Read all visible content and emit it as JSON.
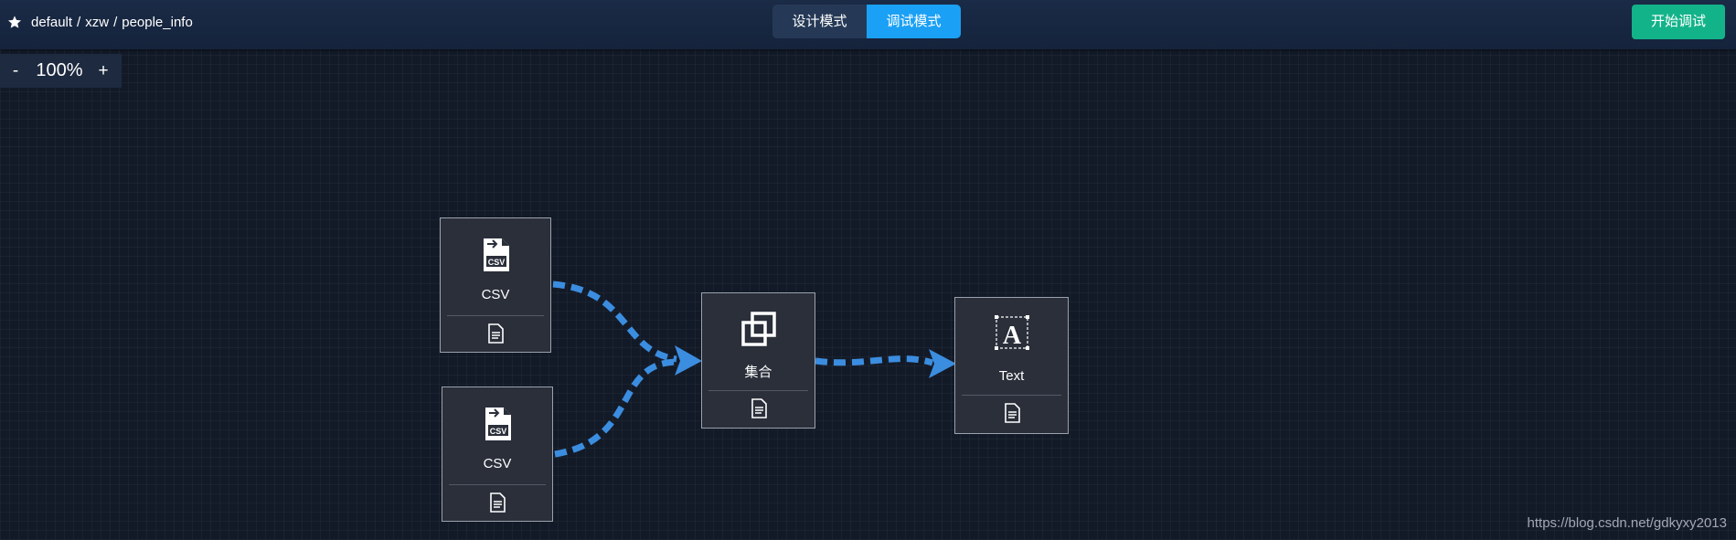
{
  "header": {
    "breadcrumb": [
      "default",
      "xzw",
      "people_info"
    ],
    "separator": "/",
    "modes": [
      {
        "label": "设计模式",
        "active": false
      },
      {
        "label": "调试模式",
        "active": true
      }
    ],
    "start_button": "开始调试"
  },
  "zoom": {
    "minus": "-",
    "value": "100%",
    "plus": "+"
  },
  "nodes": [
    {
      "id": "csv-1",
      "label": "CSV",
      "icon": "csv-file-icon"
    },
    {
      "id": "csv-2",
      "label": "CSV",
      "icon": "csv-file-icon"
    },
    {
      "id": "union",
      "label": "集合",
      "icon": "union-icon"
    },
    {
      "id": "text",
      "label": "Text",
      "icon": "text-icon"
    }
  ],
  "edges": [
    {
      "from": "csv-1",
      "to": "union"
    },
    {
      "from": "csv-2",
      "to": "union"
    },
    {
      "from": "union",
      "to": "text"
    }
  ],
  "colors": {
    "edge": "#3b8de0",
    "start_button": "#13b38a",
    "active_mode": "#1aa0f5"
  },
  "watermark": "https://blog.csdn.net/gdkyxy2013"
}
